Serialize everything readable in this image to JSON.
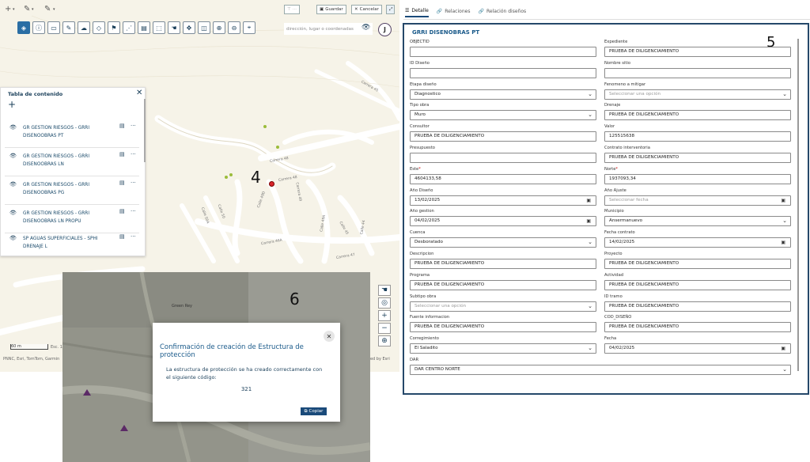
{
  "edit_toolbar": {
    "add": "+",
    "edit": "✎",
    "edit2": "✎",
    "more_btn": "···",
    "save": "Guardar",
    "cancel": "Cancelar"
  },
  "search": {
    "placeholder": "dirección, lugar o coordenadas"
  },
  "user": {
    "initial": "J"
  },
  "toc": {
    "title": "Tabla de contenido",
    "layers": [
      {
        "name": "GR GESTION RIESGOS - GRRI DISENOOBRAS PT"
      },
      {
        "name": "GR GESTION RIESGOS - GRRI DISENOOBRAS LN"
      },
      {
        "name": "GR GESTION RIESGOS - GRRI DISENOOBRAS PG"
      },
      {
        "name": "GR GESTION RIESGOS - GRRI DISENOOBRAS LN PROPU"
      },
      {
        "name": "SP AGUAS SUPERFICIALES - SPHI DRENAJE L"
      }
    ]
  },
  "map": {
    "label_4": "4",
    "label_6": "6",
    "streets": [
      "Carrera 48",
      "Carrera 48",
      "Calle 49D",
      "Carrera 49",
      "Calle 50A",
      "Calle 50",
      "Carrera 46A",
      "Calle 49A",
      "Carrera 47",
      "Calle 45",
      "Calle 44",
      "Carrera 45"
    ],
    "scale": "60 m",
    "scale_ratio": "Esc. 1: 2.256",
    "attribution": "PNNC, Esri, TomTom, Garmin",
    "attribution_right": "red by Esri",
    "sat_label": "Green Rey",
    "colors": {
      "marker_red": "#d9252b",
      "marker_green": "#9bbc3a"
    }
  },
  "dialog": {
    "title": "Confirmación de creación de Estructura de protección",
    "body": "La estructura de protección se ha creado correctamente con el siguiente código:",
    "code": "321",
    "copy": "Copiar"
  },
  "tabs": [
    {
      "label": "Detalle",
      "icon": "list-icon"
    },
    {
      "label": "Relaciones",
      "icon": "link-icon"
    },
    {
      "label": "Relación diseños",
      "icon": "link-icon"
    }
  ],
  "form": {
    "title": "GRRI DISENOBRAS PT",
    "marker": "5",
    "left": [
      {
        "label": "OBJECTID",
        "value": "",
        "type": "text"
      },
      {
        "label": "ID Diseño",
        "value": "",
        "type": "text"
      },
      {
        "label": "Etapa diseño",
        "value": "Diagnostico",
        "type": "select"
      },
      {
        "label": "Tipo obra",
        "value": "Muro",
        "type": "select"
      },
      {
        "label": "Consultor",
        "value": "PRUEBA DE DILIGENCIAMIENTO",
        "type": "text"
      },
      {
        "label": "Presupuesto",
        "value": "",
        "type": "text"
      },
      {
        "label": "Este",
        "value": "4604133,58",
        "type": "text",
        "required": "*"
      },
      {
        "label": "Año Diseño",
        "value": "13/02/2025",
        "type": "date"
      },
      {
        "label": "Año gestion",
        "value": "04/02/2025",
        "type": "date"
      },
      {
        "label": "Cuenca",
        "value": "Desboratado",
        "type": "select"
      },
      {
        "label": "Descripcion",
        "value": "PRUEBA DE DILIGENCIAMIENTO",
        "type": "text"
      },
      {
        "label": "Programa",
        "value": "PRUEBA DE DILIGENCIAMIENTO",
        "type": "text"
      },
      {
        "label": "Subtipo obra",
        "value": "Seleccionar una opción",
        "type": "select",
        "placeholder": true
      },
      {
        "label": "Fuente informacion",
        "value": "PRUEBA DE DILIGENCIAMIENTO",
        "type": "text"
      },
      {
        "label": "Corregimiento",
        "value": "El Saladito",
        "type": "select"
      },
      {
        "label": "DAR",
        "value": "DAR CENTRO NORTE",
        "type": "select",
        "wide": true
      }
    ],
    "right": [
      {
        "label": "Expediente",
        "value": "PRUEBA DE DILIGENCIAMIENTO",
        "type": "text"
      },
      {
        "label": "Nombre sitio",
        "value": "",
        "type": "text"
      },
      {
        "label": "Fenomeno a mitigar",
        "value": "Seleccionar una opción",
        "type": "select",
        "placeholder": true
      },
      {
        "label": "Drenaje",
        "value": "PRUEBA DE DILIGENCIAMIENTO",
        "type": "text"
      },
      {
        "label": "Valor",
        "value": "125515638",
        "type": "text"
      },
      {
        "label": "Contrato interventoria",
        "value": "PRUEBA DE DILIGENCIAMIENTO",
        "type": "text"
      },
      {
        "label": "Norte",
        "value": "1937093,34",
        "type": "text",
        "required": "*"
      },
      {
        "label": "Año Ajuste",
        "value": "Seleccionar fecha",
        "type": "date",
        "placeholder": true
      },
      {
        "label": "Municipio",
        "value": "Ansermanuevo",
        "type": "select"
      },
      {
        "label": "Fecha contrato",
        "value": "14/02/2025",
        "type": "date"
      },
      {
        "label": "Proyecto",
        "value": "PRUEBA DE DILIGENCIAMIENTO",
        "type": "text"
      },
      {
        "label": "Actividad",
        "value": "PRUEBA DE DILIGENCIAMIENTO",
        "type": "text"
      },
      {
        "label": "ID tramo",
        "value": "PRUEBA DE DILIGENCIAMIENTO",
        "type": "text"
      },
      {
        "label": "COD_DISEÑO",
        "value": "PRUEBA DE DILIGENCIAMIENTO",
        "type": "text"
      },
      {
        "label": "Fecha",
        "value": "04/02/2025",
        "type": "date"
      }
    ]
  }
}
